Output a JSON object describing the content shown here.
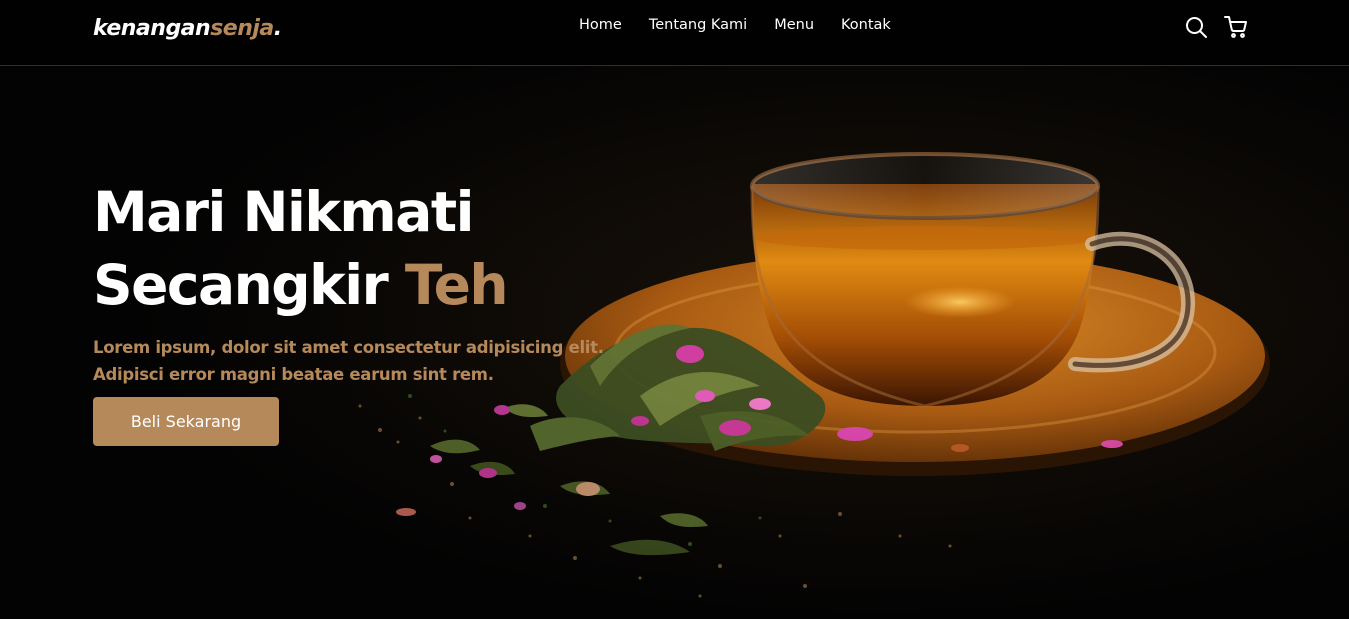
{
  "navbar": {
    "logo_main": "kenangan",
    "logo_accent": "senja",
    "logo_dot": ".",
    "links": [
      {
        "label": "Home"
      },
      {
        "label": "Tentang Kami"
      },
      {
        "label": "Menu"
      },
      {
        "label": "Kontak"
      }
    ],
    "icons": [
      "search-icon",
      "shopping-cart-icon"
    ]
  },
  "hero": {
    "title_line1": "Mari Nikmati",
    "title_line2": "Secangkir",
    "title_accent": "Teh",
    "description": "Lorem ipsum, dolor sit amet consectetur adipisicing elit. Adipisci error magni beatae earum sint rem.",
    "cta_label": "Beli Sekarang"
  },
  "colors": {
    "accent": "#b6895b",
    "background": "#000000",
    "text": "#ffffff"
  }
}
